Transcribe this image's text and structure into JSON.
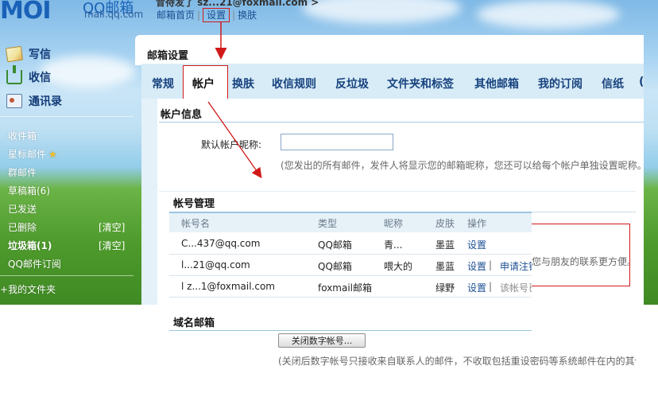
{
  "header": {
    "logo": "MOI",
    "logo_cn": "QQ邮箱",
    "logo_domain": "mail.qq.com",
    "user_line": "昔待发了 sz...21@foxmail.com >",
    "nav": [
      "邮箱首页",
      "设置",
      "换肤"
    ],
    "nav_sep": "|"
  },
  "sidebar": {
    "actions": [
      "写信",
      "收信",
      "通讯录"
    ],
    "folders": [
      {
        "label": "收件箱"
      },
      {
        "label": "星标邮件",
        "star": "★"
      },
      {
        "label": "群邮件"
      },
      {
        "label": "草稿箱(6)"
      },
      {
        "label": "已发送"
      },
      {
        "label": "已删除",
        "clear": "[清空]"
      },
      {
        "label": "垃圾箱(1)",
        "clear": "[清空]",
        "bold": true
      },
      {
        "label": "QQ邮件订阅"
      }
    ],
    "my_folders": "我的文件夹",
    "my_folders_mark": "+"
  },
  "panel": {
    "title": "邮箱设置",
    "tabs": [
      "常规",
      "帐户",
      "换肤",
      "收信规则",
      "反垃圾",
      "文件夹和标签",
      "其他邮箱",
      "我的订阅",
      "信纸",
      "("
    ],
    "active_tab_index": 1
  },
  "account_info": {
    "heading": "帐户信息",
    "nickname_label": "默认帐户昵称:",
    "nickname_value": "",
    "hint": "(您发出的所有邮件，发件人将显示您的邮箱昵称，您还可以给每个帐户单独设置昵称。"
  },
  "account_manage": {
    "heading": "帐号管理",
    "columns": [
      "帐号名",
      "类型",
      "昵称",
      "皮肤",
      "操作"
    ],
    "rows": [
      {
        "name": "C...437@qq.com",
        "type": "QQ邮箱",
        "nick": "青...",
        "skin": "墨蓝",
        "ops": [
          "设置"
        ]
      },
      {
        "name": "l...21@qq.com",
        "type": "QQ邮箱",
        "nick": "喂大的",
        "skin": "墨蓝",
        "ops": [
          "设置",
          "|",
          "申请注销"
        ]
      },
      {
        "name": "l z...1@foxmail.com",
        "type": "foxmail邮箱",
        "nick": "",
        "skin": "绿野",
        "ops": [
          "设置",
          "|",
          "该帐号已"
        ]
      }
    ],
    "overflow_hint": "您与朋友的联系更方便。"
  },
  "domain_mail": {
    "heading": "域名邮箱",
    "button_label": "关闭数字帐号...",
    "hint": "(关闭后数字帐号只接收来自联系人的邮件，不收取包括重设密码等系统邮件在内的其他"
  },
  "colors": {
    "accent_blue": "#1a62b8",
    "link_blue": "#1c4f94",
    "annotation_red": "#d01a1a",
    "tab_bar": "#d8ecf7"
  }
}
